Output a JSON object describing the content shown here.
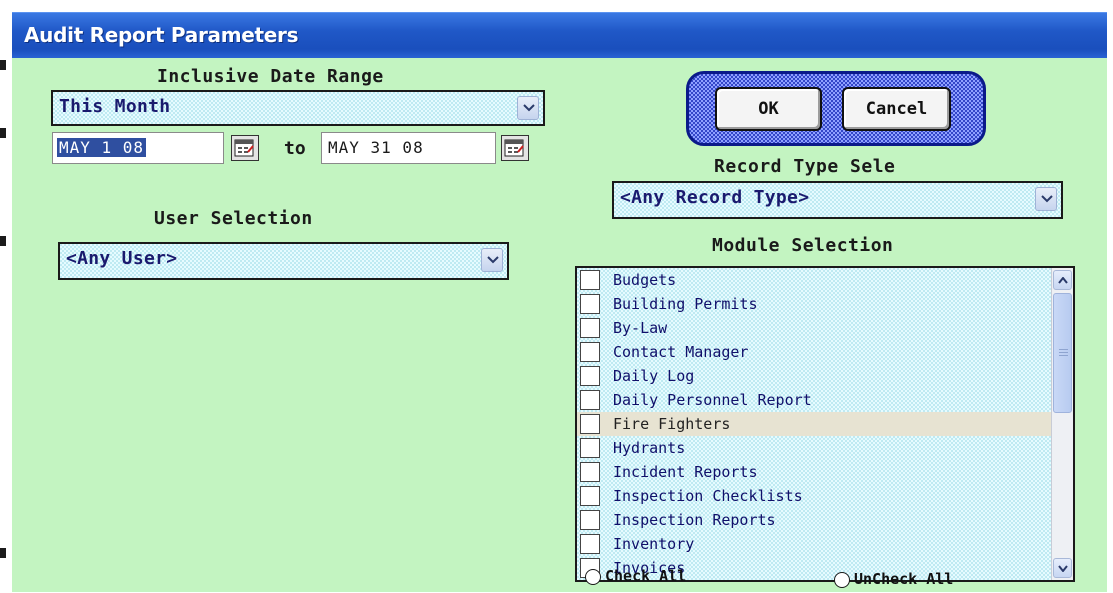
{
  "window": {
    "title": "Audit Report Parameters"
  },
  "colors": {
    "background": "#c3f4c1",
    "titlebar": "#2058c7",
    "field_text": "#1a1a6e"
  },
  "date_range": {
    "heading": "Inclusive Date Range",
    "preset": "This Month",
    "from": "MAY 1 08",
    "to_label": "to",
    "to": "MAY 31 08"
  },
  "user_selection": {
    "heading": "User Selection",
    "value": "<Any User>"
  },
  "buttons": {
    "ok": "OK",
    "cancel": "Cancel"
  },
  "record_type": {
    "heading": "Record Type Sele",
    "value": "<Any Record Type>"
  },
  "modules": {
    "heading": "Module Selection",
    "items": [
      "Budgets",
      "Building Permits",
      "By-Law",
      "Contact Manager",
      "Daily Log",
      "Daily Personnel Report",
      "Fire Fighters",
      "Hydrants",
      "Incident Reports",
      "Inspection Checklists",
      "Inspection Reports",
      "Inventory",
      "Invoices"
    ],
    "highlighted": "Fire Fighters",
    "check_all": "Check All",
    "uncheck_all": "UnCheck All"
  },
  "icons": {
    "dropdown": "chevron-down-icon",
    "calendar": "calendar-icon",
    "scroll_up": "scroll-up-icon",
    "scroll_down": "scroll-down-icon"
  }
}
